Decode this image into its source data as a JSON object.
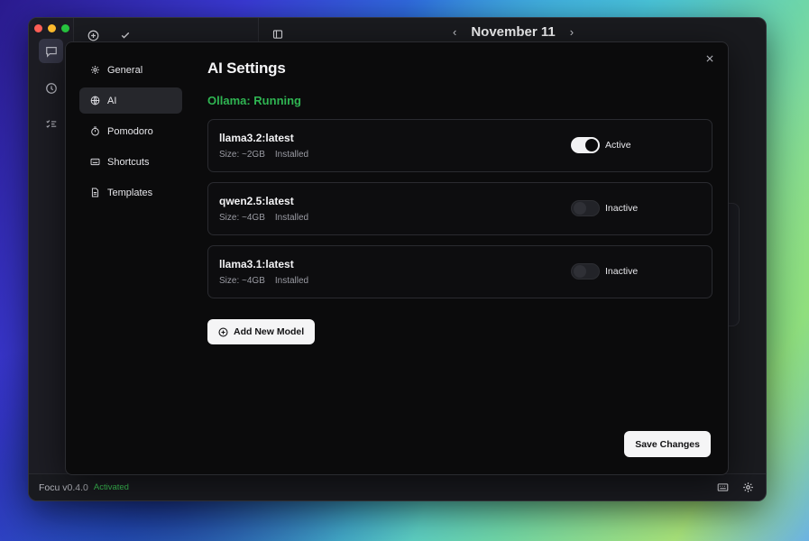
{
  "window": {
    "date_title": "November 11",
    "prev_icon": "chevron-left-icon",
    "next_icon": "chevron-right-icon"
  },
  "statusbar": {
    "version": "Focu v0.4.0",
    "license": "Activated"
  },
  "settings": {
    "title": "AI Settings",
    "nav": [
      {
        "label": "General",
        "icon": "gear-icon"
      },
      {
        "label": "AI",
        "icon": "globe-icon",
        "active": true
      },
      {
        "label": "Pomodoro",
        "icon": "timer-icon"
      },
      {
        "label": "Shortcuts",
        "icon": "keyboard-icon"
      },
      {
        "label": "Templates",
        "icon": "document-icon"
      }
    ],
    "ollama_status": "Ollama: Running",
    "models": [
      {
        "name": "llama3.2:latest",
        "size": "Size: ~2GB",
        "status": "Installed",
        "enabled": true,
        "state_label": "Active"
      },
      {
        "name": "qwen2.5:latest",
        "size": "Size: ~4GB",
        "status": "Installed",
        "enabled": false,
        "state_label": "Inactive"
      },
      {
        "name": "llama3.1:latest",
        "size": "Size: ~4GB",
        "status": "Installed",
        "enabled": false,
        "state_label": "Inactive"
      }
    ],
    "add_model_label": "Add New Model",
    "save_label": "Save Changes"
  },
  "colors": {
    "running_green": "#2fb552",
    "activated_green": "#3fcf5a",
    "modal_bg": "#0b0b0c"
  }
}
